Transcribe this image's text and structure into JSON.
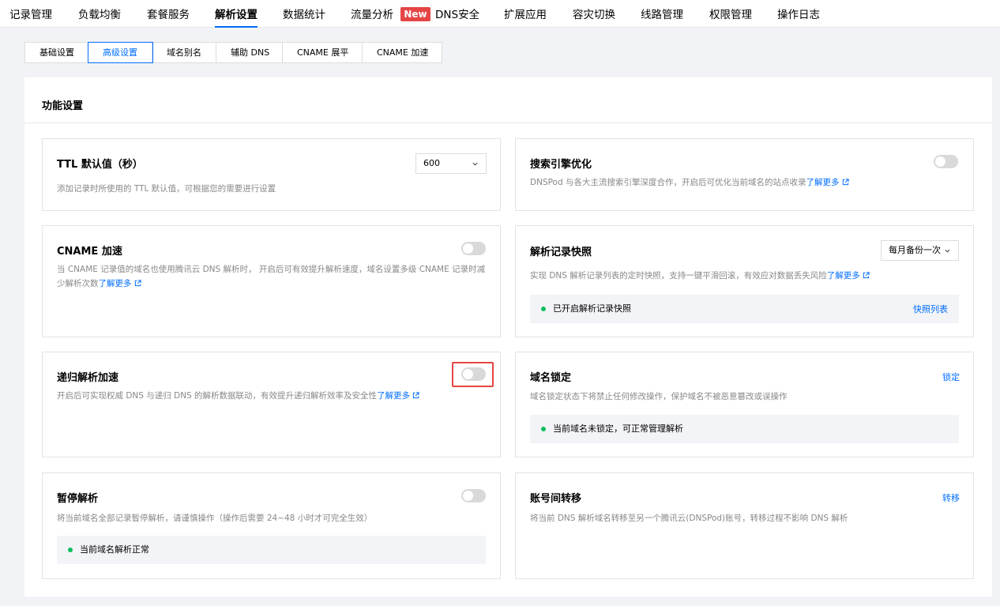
{
  "topnav": {
    "items": [
      "记录管理",
      "负载均衡",
      "套餐服务",
      "解析设置",
      "数据统计",
      "流量分析",
      "DNS安全",
      "扩展应用",
      "容灾切换",
      "线路管理",
      "权限管理",
      "操作日志"
    ],
    "active_index": 3,
    "new_badge": "New"
  },
  "subtabs": {
    "items": [
      "基础设置",
      "高级设置",
      "域名别名",
      "辅助 DNS",
      "CNAME 展平",
      "CNAME 加速"
    ],
    "active_index": 1
  },
  "panel": {
    "title": "功能设置"
  },
  "link_text": "了解更多",
  "cards": {
    "ttl": {
      "title": "TTL 默认值（秒）",
      "desc": "添加记录时所使用的 TTL 默认值，可根据您的需要进行设置",
      "select_value": "600"
    },
    "seo": {
      "title": "搜索引擎优化",
      "desc": "DNSPod 与各大主流搜索引擎深度合作，开启后可优化当前域名的站点收录",
      "toggle": false
    },
    "cname": {
      "title": "CNAME 加速",
      "desc": "当 CNAME 记录值的域名也使用腾讯云 DNS 解析时， 开启后可有效提升解析速度，域名设置多级 CNAME 记录时减少解析次数",
      "toggle": false
    },
    "snapshot": {
      "title": "解析记录快照",
      "desc": "实现 DNS 解析记录列表的定时快照，支持一键平滑回滚，有效应对数据丢失风险",
      "select_value": "每月备份一次",
      "status": "已开启解析记录快照",
      "action": "快照列表"
    },
    "recursive": {
      "title": "递归解析加速",
      "desc": "开启后可实现权威 DNS 与递归 DNS 的解析数据联动，有效提升递归解析效率及安全性",
      "toggle": false
    },
    "lock": {
      "title": "域名锁定",
      "desc": "域名锁定状态下将禁止任何修改操作，保护域名不被恶意篡改或误操作",
      "status": "当前域名未锁定，可正常管理解析",
      "action": "锁定"
    },
    "pause": {
      "title": "暂停解析",
      "desc": "将当前域名全部记录暂停解析，请谨慎操作（操作后需要 24~48 小时才可完全生效）",
      "status": "当前域名解析正常",
      "toggle": false
    },
    "transfer": {
      "title": "账号间转移",
      "desc": "将当前 DNS 解析域名转移至另一个腾讯云(DNSPod)账号，转移过程不影响 DNS 解析",
      "action": "转移"
    }
  },
  "colors": {
    "accent": "#006eff",
    "highlight": "#e54545",
    "status_ok": "#0abf5b"
  }
}
